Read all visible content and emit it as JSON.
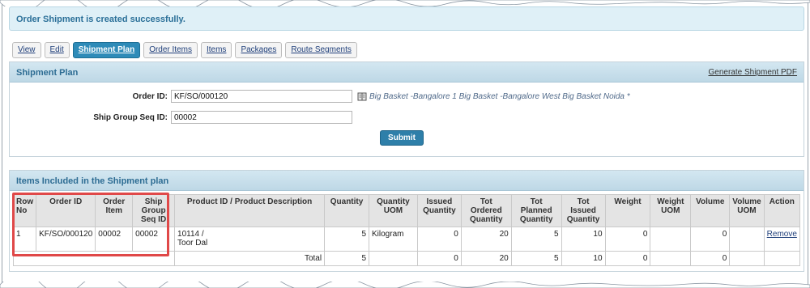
{
  "message": "Order Shipment is created successfully.",
  "tabs": [
    "View",
    "Edit",
    "Shipment Plan",
    "Order Items",
    "Items",
    "Packages",
    "Route Segments"
  ],
  "shipment_plan": {
    "title": "Shipment Plan",
    "pdf_link": "Generate Shipment PDF",
    "order_id_label": "Order ID:",
    "order_id_value": "KF/SO/000120",
    "order_hint": "Big Basket -Bangalore 1 Big Basket -Bangalore West Big Basket Noida *",
    "ship_group_label": "Ship Group Seq ID:",
    "ship_group_value": "00002",
    "submit_label": "Submit"
  },
  "items": {
    "title": "Items Included in the Shipment plan",
    "columns": [
      "Row No",
      "Order ID",
      "Order Item",
      "Ship Group Seq ID",
      "Product ID / Product Description",
      "Quantity",
      "Quantity UOM",
      "Issued Quantity",
      "Tot Ordered Quantity",
      "Tot Planned Quantity",
      "Tot Issued Quantity",
      "Weight",
      "Weight UOM",
      "Volume",
      "Volume UOM",
      "Action"
    ],
    "row": {
      "row_no": "1",
      "order_id": "KF/SO/000120",
      "order_item": "00002",
      "ship_group": "00002",
      "product_id": "10114 /",
      "product_desc": "Toor Dal",
      "quantity": "5",
      "quantity_uom": "Kilogram",
      "issued": "0",
      "tot_ordered": "20",
      "tot_planned": "5",
      "tot_issued": "10",
      "weight": "0",
      "weight_uom": "",
      "volume": "0",
      "volume_uom": "",
      "action": "Remove"
    },
    "total": {
      "label": "Total",
      "quantity": "5",
      "issued": "0",
      "tot_ordered": "20",
      "tot_planned": "5",
      "tot_issued": "10",
      "weight": "0",
      "volume": "0"
    }
  },
  "colors": {
    "accent": "#2e8bb8",
    "highlight": "#e04848"
  },
  "icons": {
    "order_hint_icon": "book-icon"
  }
}
